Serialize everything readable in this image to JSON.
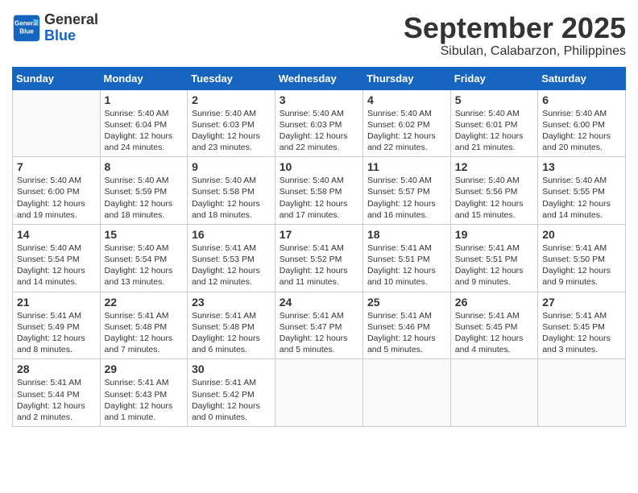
{
  "header": {
    "logo_general": "General",
    "logo_blue": "Blue",
    "month": "September 2025",
    "location": "Sibulan, Calabarzon, Philippines"
  },
  "days_of_week": [
    "Sunday",
    "Monday",
    "Tuesday",
    "Wednesday",
    "Thursday",
    "Friday",
    "Saturday"
  ],
  "weeks": [
    [
      {
        "day": "",
        "info": ""
      },
      {
        "day": "1",
        "info": "Sunrise: 5:40 AM\nSunset: 6:04 PM\nDaylight: 12 hours\nand 24 minutes."
      },
      {
        "day": "2",
        "info": "Sunrise: 5:40 AM\nSunset: 6:03 PM\nDaylight: 12 hours\nand 23 minutes."
      },
      {
        "day": "3",
        "info": "Sunrise: 5:40 AM\nSunset: 6:03 PM\nDaylight: 12 hours\nand 22 minutes."
      },
      {
        "day": "4",
        "info": "Sunrise: 5:40 AM\nSunset: 6:02 PM\nDaylight: 12 hours\nand 22 minutes."
      },
      {
        "day": "5",
        "info": "Sunrise: 5:40 AM\nSunset: 6:01 PM\nDaylight: 12 hours\nand 21 minutes."
      },
      {
        "day": "6",
        "info": "Sunrise: 5:40 AM\nSunset: 6:00 PM\nDaylight: 12 hours\nand 20 minutes."
      }
    ],
    [
      {
        "day": "7",
        "info": "Sunrise: 5:40 AM\nSunset: 6:00 PM\nDaylight: 12 hours\nand 19 minutes."
      },
      {
        "day": "8",
        "info": "Sunrise: 5:40 AM\nSunset: 5:59 PM\nDaylight: 12 hours\nand 18 minutes."
      },
      {
        "day": "9",
        "info": "Sunrise: 5:40 AM\nSunset: 5:58 PM\nDaylight: 12 hours\nand 18 minutes."
      },
      {
        "day": "10",
        "info": "Sunrise: 5:40 AM\nSunset: 5:58 PM\nDaylight: 12 hours\nand 17 minutes."
      },
      {
        "day": "11",
        "info": "Sunrise: 5:40 AM\nSunset: 5:57 PM\nDaylight: 12 hours\nand 16 minutes."
      },
      {
        "day": "12",
        "info": "Sunrise: 5:40 AM\nSunset: 5:56 PM\nDaylight: 12 hours\nand 15 minutes."
      },
      {
        "day": "13",
        "info": "Sunrise: 5:40 AM\nSunset: 5:55 PM\nDaylight: 12 hours\nand 14 minutes."
      }
    ],
    [
      {
        "day": "14",
        "info": "Sunrise: 5:40 AM\nSunset: 5:54 PM\nDaylight: 12 hours\nand 14 minutes."
      },
      {
        "day": "15",
        "info": "Sunrise: 5:40 AM\nSunset: 5:54 PM\nDaylight: 12 hours\nand 13 minutes."
      },
      {
        "day": "16",
        "info": "Sunrise: 5:41 AM\nSunset: 5:53 PM\nDaylight: 12 hours\nand 12 minutes."
      },
      {
        "day": "17",
        "info": "Sunrise: 5:41 AM\nSunset: 5:52 PM\nDaylight: 12 hours\nand 11 minutes."
      },
      {
        "day": "18",
        "info": "Sunrise: 5:41 AM\nSunset: 5:51 PM\nDaylight: 12 hours\nand 10 minutes."
      },
      {
        "day": "19",
        "info": "Sunrise: 5:41 AM\nSunset: 5:51 PM\nDaylight: 12 hours\nand 9 minutes."
      },
      {
        "day": "20",
        "info": "Sunrise: 5:41 AM\nSunset: 5:50 PM\nDaylight: 12 hours\nand 9 minutes."
      }
    ],
    [
      {
        "day": "21",
        "info": "Sunrise: 5:41 AM\nSunset: 5:49 PM\nDaylight: 12 hours\nand 8 minutes."
      },
      {
        "day": "22",
        "info": "Sunrise: 5:41 AM\nSunset: 5:48 PM\nDaylight: 12 hours\nand 7 minutes."
      },
      {
        "day": "23",
        "info": "Sunrise: 5:41 AM\nSunset: 5:48 PM\nDaylight: 12 hours\nand 6 minutes."
      },
      {
        "day": "24",
        "info": "Sunrise: 5:41 AM\nSunset: 5:47 PM\nDaylight: 12 hours\nand 5 minutes."
      },
      {
        "day": "25",
        "info": "Sunrise: 5:41 AM\nSunset: 5:46 PM\nDaylight: 12 hours\nand 5 minutes."
      },
      {
        "day": "26",
        "info": "Sunrise: 5:41 AM\nSunset: 5:45 PM\nDaylight: 12 hours\nand 4 minutes."
      },
      {
        "day": "27",
        "info": "Sunrise: 5:41 AM\nSunset: 5:45 PM\nDaylight: 12 hours\nand 3 minutes."
      }
    ],
    [
      {
        "day": "28",
        "info": "Sunrise: 5:41 AM\nSunset: 5:44 PM\nDaylight: 12 hours\nand 2 minutes."
      },
      {
        "day": "29",
        "info": "Sunrise: 5:41 AM\nSunset: 5:43 PM\nDaylight: 12 hours\nand 1 minute."
      },
      {
        "day": "30",
        "info": "Sunrise: 5:41 AM\nSunset: 5:42 PM\nDaylight: 12 hours\nand 0 minutes."
      },
      {
        "day": "",
        "info": ""
      },
      {
        "day": "",
        "info": ""
      },
      {
        "day": "",
        "info": ""
      },
      {
        "day": "",
        "info": ""
      }
    ]
  ]
}
